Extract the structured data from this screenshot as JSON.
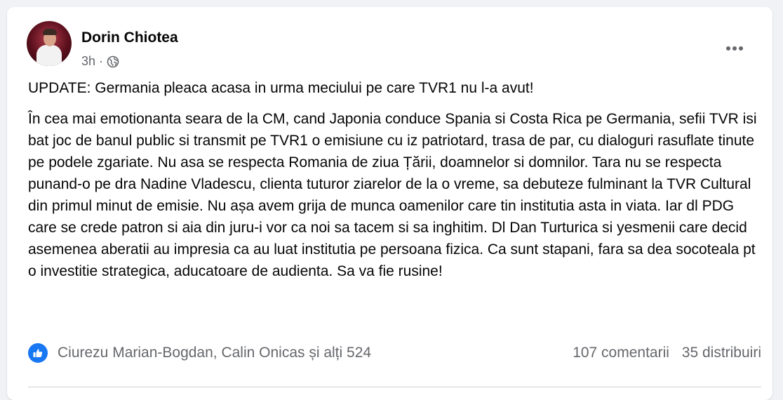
{
  "post": {
    "author": "Dorin Chiotea",
    "time": "3h",
    "separator": "·",
    "audience_icon": "globe-icon",
    "more_icon": "more-horizontal-icon",
    "paragraphs": [
      "UPDATE: Germania pleaca acasa in urma meciului pe care TVR1 nu l-a avut!",
      "În cea mai emotionanta seara de la CM, cand Japonia conduce Spania si Costa Rica pe Germania, sefii TVR isi bat joc de banul public si transmit pe TVR1 o emisiune cu iz patriotard, trasa de par, cu dialoguri rasuflate tinute pe podele zgariate. Nu asa se respecta Romania de ziua Țării, doamnelor si domnilor. Tara nu se respecta punand-o pe dra Nadine Vladescu, clienta tuturor ziarelor de la o vreme, sa debuteze fulminant la TVR Cultural din primul minut de emisie. Nu așa avem grija de munca oamenilor care tin institutia asta in viata. Iar dl PDG care se crede patron si aia din juru-i vor ca noi sa tacem si sa inghitim. Dl Dan Turturica si yesmenii care decid asemenea aberatii au impresia ca au luat institutia pe persoana fizica. Ca sunt stapani, fara sa dea socoteala pt o investitie strategica, aducatoare de audienta. Sa va fie rusine!"
    ]
  },
  "engagement": {
    "reaction_icon": "like-icon",
    "reactions_text": "Ciurezu Marian-Bogdan, Calin Onicas și alți 524",
    "comments": "107 comentarii",
    "shares": "35 distribuiri"
  },
  "colors": {
    "accent": "#1877f2",
    "text_primary": "#050505",
    "text_secondary": "#65676b",
    "background": "#f0f2f5"
  }
}
